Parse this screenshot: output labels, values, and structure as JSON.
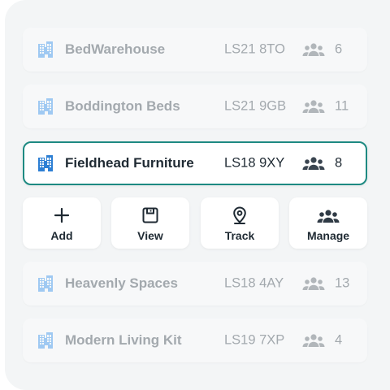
{
  "rows_top": [
    {
      "name": "BedWarehouse",
      "code": "LS21 8TO",
      "count": "6"
    },
    {
      "name": "Boddington Beds",
      "code": "LS21 9GB",
      "count": "11"
    }
  ],
  "selected": {
    "name": "Fieldhead Furniture",
    "code": "LS18 9XY",
    "count": "8"
  },
  "actions": {
    "add": "Add",
    "view": "View",
    "track": "Track",
    "manage": "Manage"
  },
  "rows_bottom": [
    {
      "name": "Heavenly Spaces",
      "code": "LS18 4AY",
      "count": "13"
    },
    {
      "name": "Modern Living Kit",
      "code": "LS19 7XP",
      "count": "4"
    }
  ],
  "colors": {
    "selected_border": "#1e8a82",
    "building_icon": "#2d7fd4",
    "building_icon_dim": "#9fc9f2",
    "text_dark": "#1f2a33",
    "text_dim": "#a3a9ae"
  },
  "icons": {
    "row": "building-icon",
    "members": "people-icon",
    "add": "plus-icon",
    "view": "save-icon",
    "track": "location-pin-icon",
    "manage": "people-icon"
  }
}
